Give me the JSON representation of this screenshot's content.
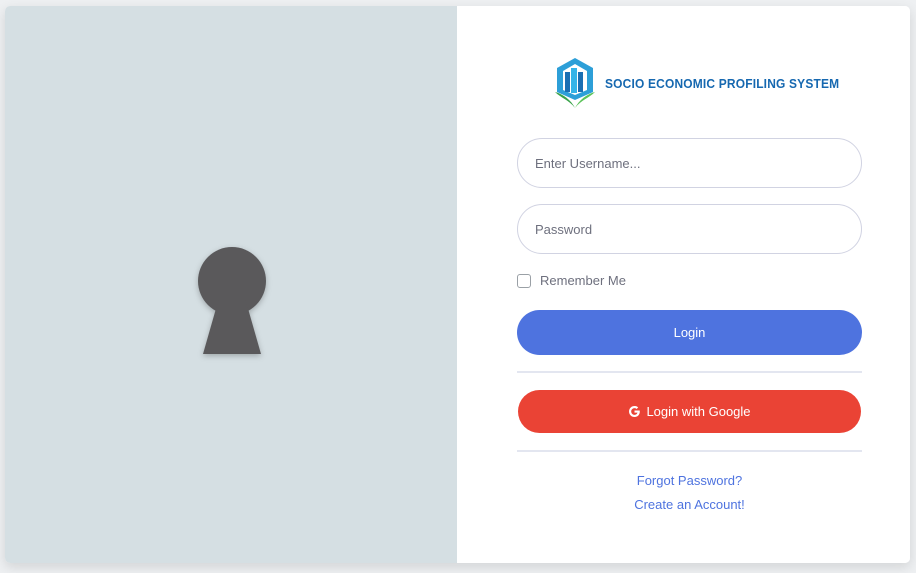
{
  "brand": {
    "name": "SOCIO ECONOMIC PROFILING SYSTEM",
    "logo_icon": "building-hands-logo"
  },
  "login_form": {
    "username_placeholder": "Enter Username...",
    "password_placeholder": "Password",
    "remember_label": "Remember Me",
    "remember_checked": false,
    "login_label": "Login",
    "google_label": "Login with Google",
    "google_icon": "google-g-icon"
  },
  "links": {
    "forgot_password": "Forgot Password?",
    "create_account": "Create an Account!"
  },
  "decor": {
    "keyhole_icon": "keyhole-icon"
  },
  "colors": {
    "left_panel": "#d5dfe3",
    "brand_text": "#1668b0",
    "primary": "#4e73df",
    "google": "#ea4335",
    "keyhole": "#5a595b"
  }
}
